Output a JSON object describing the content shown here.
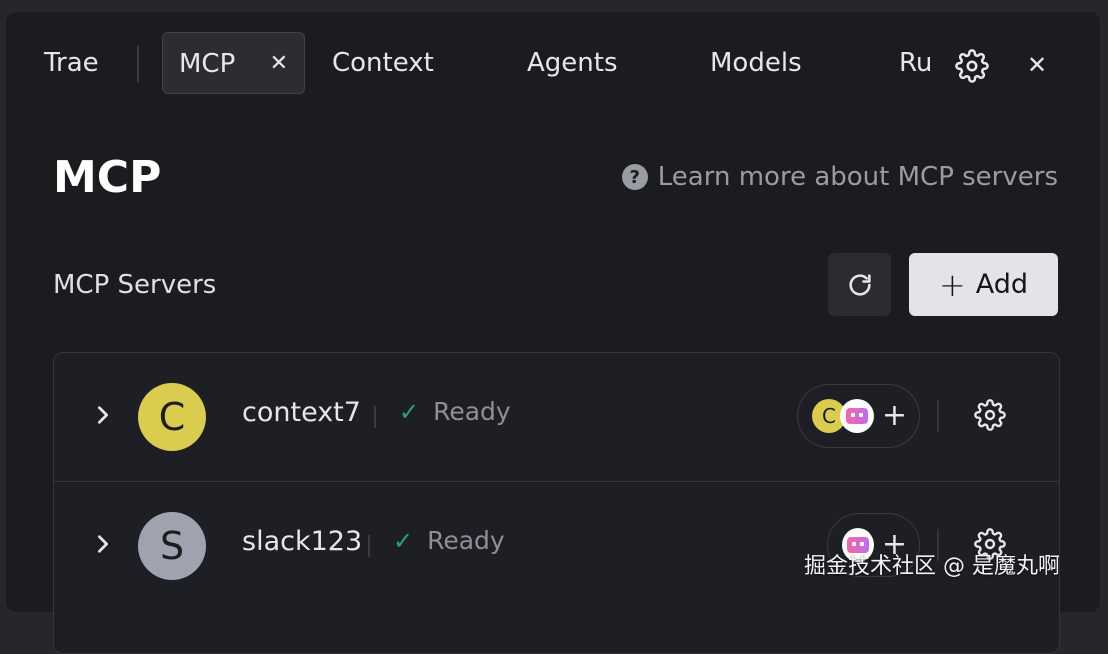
{
  "tabs": [
    {
      "label": "Trae"
    },
    {
      "label": "MCP",
      "active": true
    },
    {
      "label": "Context"
    },
    {
      "label": "Agents"
    },
    {
      "label": "Models"
    },
    {
      "label": "Ru"
    }
  ],
  "header": {
    "title": "MCP",
    "help_link": "Learn more about MCP servers",
    "help_icon_glyph": "?"
  },
  "servers_section": {
    "title": "MCP Servers",
    "add_label": "Add",
    "add_icon_glyph": "+"
  },
  "servers": [
    {
      "name": "context7",
      "status": "Ready",
      "avatar_letter": "C",
      "avatar_color": "#d9cc4f",
      "tools": [
        "C",
        "robot"
      ]
    },
    {
      "name": "slack123",
      "status": "Ready",
      "avatar_letter": "S",
      "avatar_color": "#9fa3b0",
      "tools": [
        "robot"
      ]
    }
  ],
  "watermark": "掘金技术社区 @ 是魔丸啊",
  "colors": {
    "accent": "#2ba471",
    "panel": "#1b1c20",
    "add_button": "#e2e4ea"
  }
}
